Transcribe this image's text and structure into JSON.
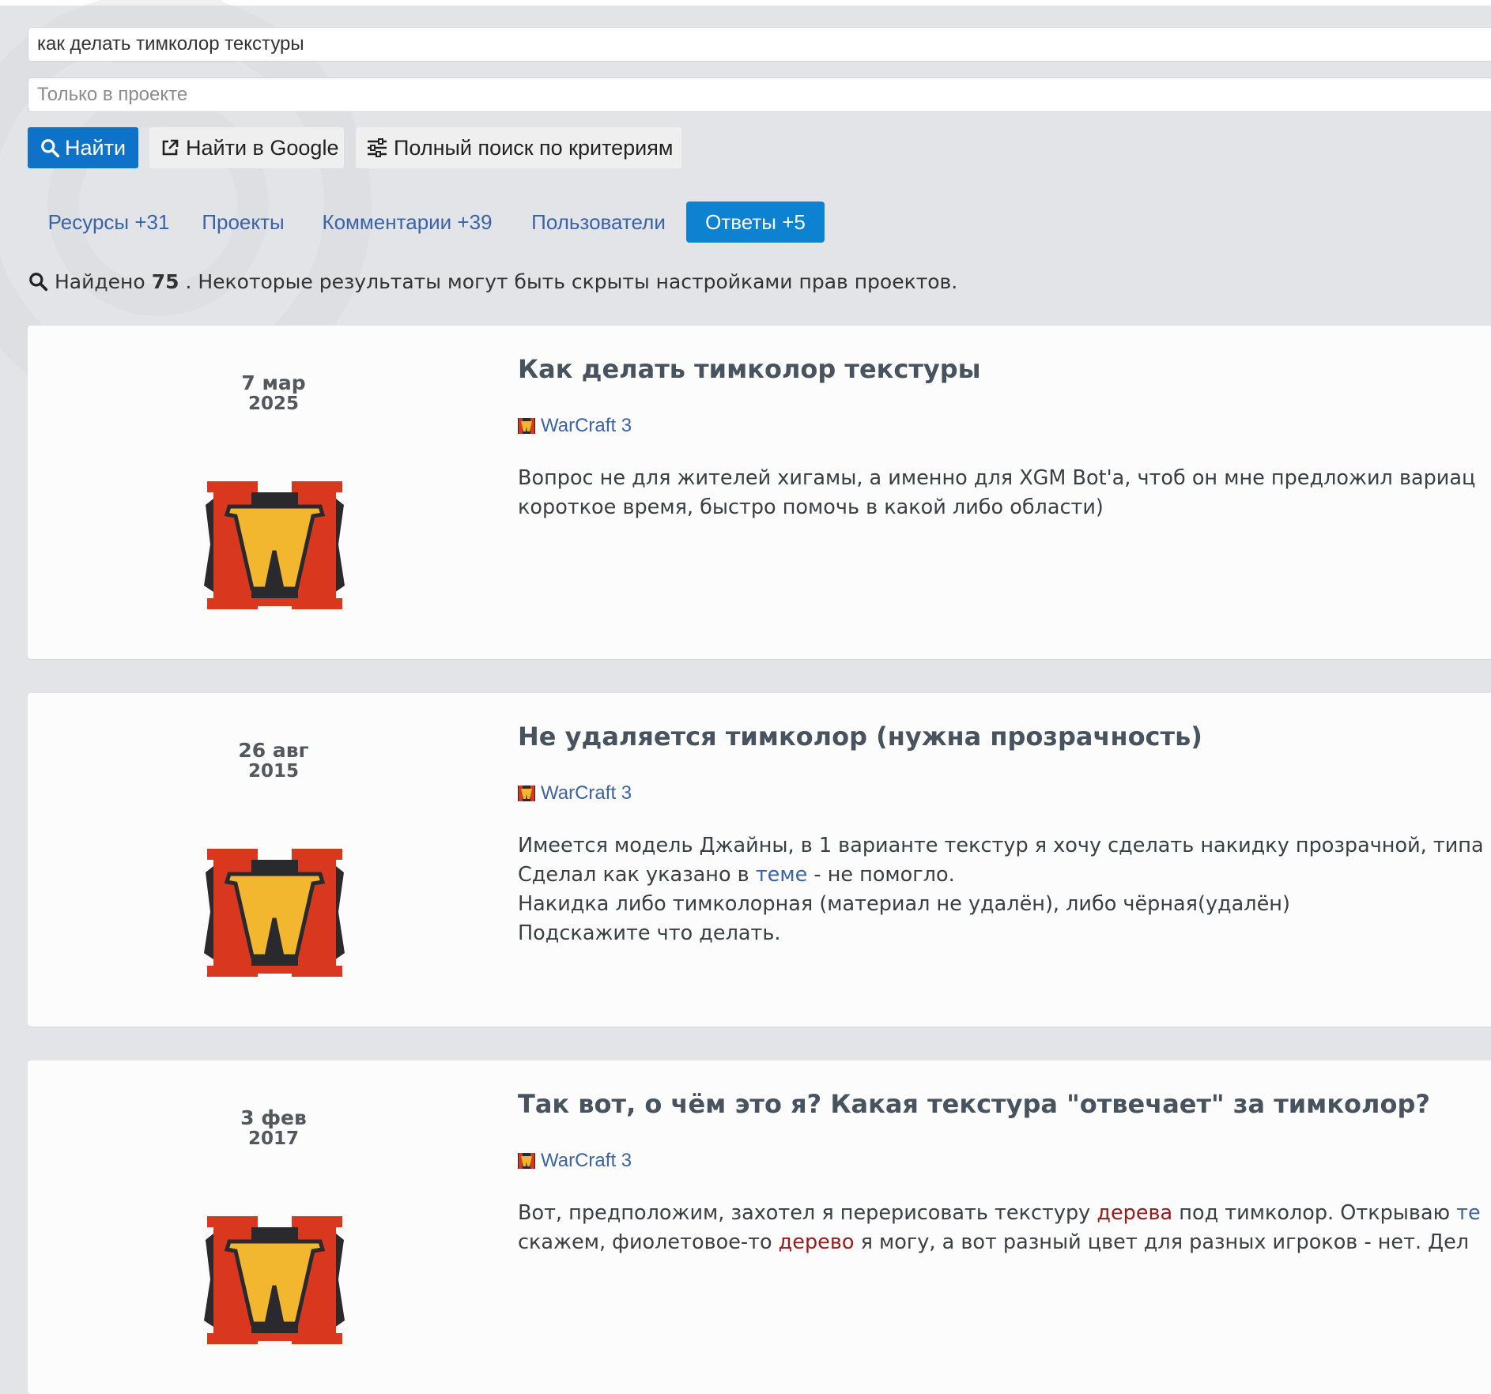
{
  "search": {
    "query": "как делать тимколор текстуры",
    "project_placeholder": "Только в проекте"
  },
  "buttons": {
    "find": "Найти",
    "google": "Найти в Google",
    "full_search": "Полный поиск по критериям"
  },
  "tabs": [
    {
      "label": "Ресурсы +31",
      "active": false
    },
    {
      "label": "Проекты",
      "active": false
    },
    {
      "label": "Комментарии +39",
      "active": false
    },
    {
      "label": "Пользователи",
      "active": false
    },
    {
      "label": "Ответы +5",
      "active": true
    }
  ],
  "summary": {
    "prefix": "Найдено",
    "count": "75",
    "suffix": ". Некоторые результаты могут быть скрыты настройками прав проектов."
  },
  "colors": {
    "primary": "#0d72c8",
    "active_tab": "#0d82d1",
    "link": "#3a63a8",
    "highlight": "#9a1a1a",
    "background": "#e3e4e8"
  },
  "results": [
    {
      "date_day": "7 мар",
      "date_year": "2025",
      "title": "Как делать тимколор текстуры",
      "project": "WarCraft 3",
      "icon": "warcraft3-logo-icon",
      "line1": "Вопрос не для жителей хигамы, а именно для XGM Bot'a, чтоб он мне предложил вариац",
      "line2": "короткое время, быстро помочь в какой либо области)"
    },
    {
      "date_day": "26 авг",
      "date_year": "2015",
      "title": "Не удаляется тимколор (нужна прозрачность)",
      "project": "WarCraft 3",
      "icon": "warcraft3-logo-icon",
      "line1": "Имеется модель Джайны, в 1 варианте текстур я хочу сделать накидку прозрачной, типа",
      "line2_a": "Сделал как указано в ",
      "line2_link": "теме",
      "line2_b": " - не помогло.",
      "line3": "Накидка либо тимколорная (материал не удалён), либо чёрная(удалён)",
      "line4": "Подскажите что делать."
    },
    {
      "date_day": "3 фев",
      "date_year": "2017",
      "title": "Так вот, о чём это я? Какая текстура \"отвечает\" за тимколор?",
      "project": "WarCraft 3",
      "icon": "warcraft3-logo-icon",
      "line1_a": "Вот, предположим, захотел я перерисовать текстуру ",
      "line1_hl": "дерева",
      "line1_b": " под тимколор. Открываю ",
      "line1_link": "те",
      "line2_a": "скажем, фиолетовое-то ",
      "line2_hl": "дерево",
      "line2_b": " я могу, а вот разный цвет для разных игроков - нет. Дел"
    }
  ]
}
